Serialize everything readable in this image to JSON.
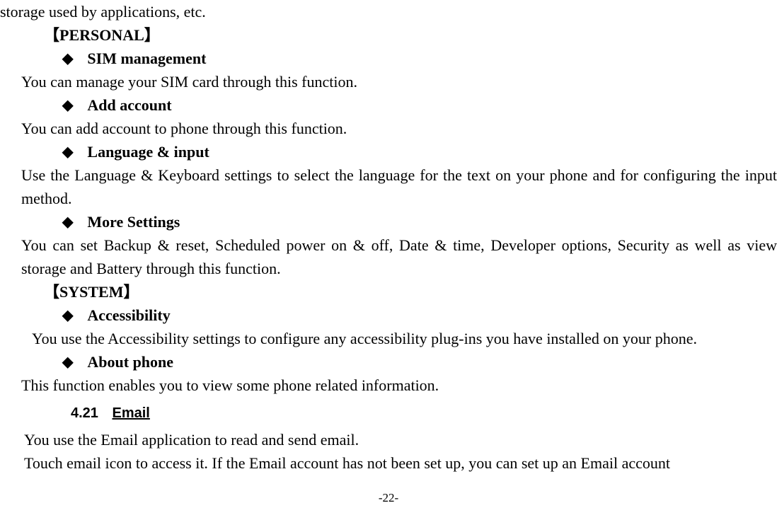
{
  "line_top": "storage used by applications, etc.",
  "section_personal": "【PERSONAL】",
  "bullet_sim": "SIM management",
  "desc_sim": "You can manage your SIM card through this function.",
  "bullet_add_account": "Add account",
  "desc_add_account": "You can add account to phone through this function.",
  "bullet_language": "Language & input",
  "desc_language": "Use the Language & Keyboard settings to select the language for the text on your phone and for configuring the input method.",
  "bullet_more_settings": "More Settings",
  "desc_more_settings": "You can set Backup & reset, Scheduled power on & off, Date & time, Developer options, Security as well as view storage and Battery through this function.",
  "section_system": "【SYSTEM】",
  "bullet_accessibility": "Accessibility",
  "desc_accessibility": "You use the Accessibility settings to configure any accessibility plug-ins you have installed on your phone.",
  "bullet_about_phone": "About phone",
  "desc_about_phone": "This function enables you to view some phone related information.",
  "heading_number": "4.21",
  "heading_title": "Email",
  "desc_email_1": "You use the Email application to read and send email.",
  "desc_email_2": "Touch email icon to access it. If the Email account has not been set up, you can set up an Email account",
  "page_number": "-22-"
}
